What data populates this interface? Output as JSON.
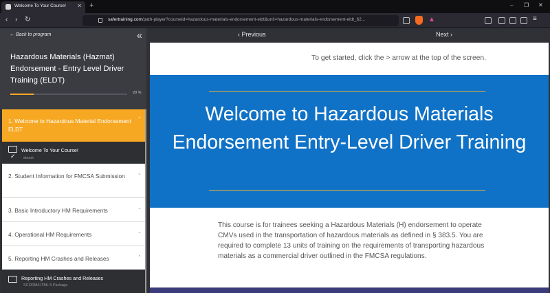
{
  "browser": {
    "tab_title": "Welcome To Your Course!",
    "tab_close": "✕",
    "new_tab": "+",
    "url_domain": "safertraining.com",
    "url_path": "/path-player?courseid=hazardous-materials-endorsement-eldt&unit=hazardous-materials-endorsement-eldt_62...",
    "window_controls": [
      "–",
      "❐",
      "✕"
    ],
    "nav": {
      "back": "‹",
      "forward": "›",
      "reload": "↻"
    }
  },
  "sidebar": {
    "back_label": "← Back to program",
    "collapse": "«",
    "course_title": "Hazardous Materials (Hazmat) Endorsement - Entry Level Driver Training (ELDT)",
    "progress_percent": 20,
    "progress_label": "20 %",
    "units": [
      {
        "label": "1. Welcome to Hazardous Material Endorsement ELDT",
        "chevron": "⌃",
        "active": true
      },
      {
        "label": "2. Student Information for FMCSA Submission",
        "chevron": "⌄"
      },
      {
        "label": "3. Basic Introductory HM Requirements",
        "chevron": "⌄"
      },
      {
        "label": "4. Operational HM Requirements",
        "chevron": "⌄"
      },
      {
        "label": "5. Reporting HM Crashes and Releases",
        "chevron": "⌃"
      }
    ],
    "lessons": [
      {
        "title": "Welcome To Your Course!",
        "type": "ebook",
        "check": "✓"
      },
      {
        "title": "Reporting HM Crashes and Releases",
        "type": "SCORM/HTML 5 Package"
      }
    ]
  },
  "main": {
    "prev_label": "‹ Previous",
    "next_label": "Next ›",
    "hint": "To get started, click the > arrow at the top of the screen.",
    "banner_title": "Welcome to Hazardous Materials Endorsement Entry-Level Driver Training",
    "description": "This course is for trainees seeking a Hazardous Materials (H) endorsement to operate CMVs used in the transportation of hazardous materials as defined in § 383.5. You are required to complete 13 units of training on the requirements of transporting hazardous materials as a commercial driver outlined in the FMCSA regulations."
  },
  "colors": {
    "accent": "#f7a823",
    "banner": "#1072c6",
    "sidebar_bg": "#2f3136"
  }
}
